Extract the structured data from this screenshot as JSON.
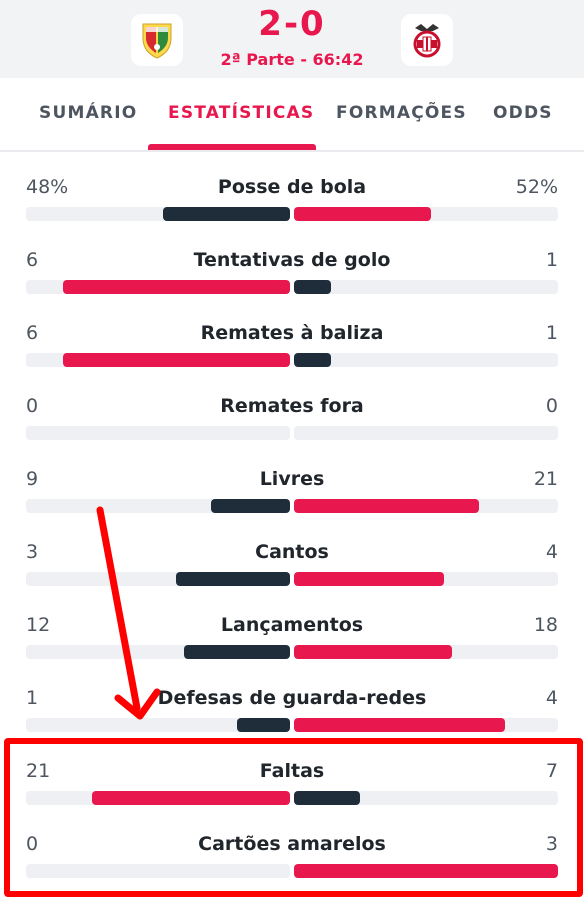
{
  "match": {
    "score": "2-0",
    "period": "2ª Parte - 66:42",
    "home_crest_icon": "estoril-crest-icon",
    "away_crest_icon": "benfica-crest-icon"
  },
  "tabs": [
    {
      "label": "SUMÁRIO"
    },
    {
      "label": "ESTATÍSTICAS",
      "active": true
    },
    {
      "label": "FORMAÇÕES"
    },
    {
      "label": "ODDS"
    }
  ],
  "colors": {
    "accent": "#e8174d",
    "dark_bar": "#1f2d3a",
    "track": "#eef0f3",
    "annotation": "#ff0000"
  },
  "stats": [
    {
      "name": "Posse de bola",
      "left": "48%",
      "right": "52%",
      "left_fill": 0.48,
      "right_fill": 0.52,
      "left_color": "dark",
      "right_color": "accent"
    },
    {
      "name": "Tentativas de golo",
      "left": "6",
      "right": "1",
      "left_fill": 0.86,
      "right_fill": 0.14,
      "left_color": "accent",
      "right_color": "dark"
    },
    {
      "name": "Remates à baliza",
      "left": "6",
      "right": "1",
      "left_fill": 0.86,
      "right_fill": 0.14,
      "left_color": "accent",
      "right_color": "dark"
    },
    {
      "name": "Remates fora",
      "left": "0",
      "right": "0",
      "left_fill": 0,
      "right_fill": 0,
      "left_color": "dark",
      "right_color": "dark"
    },
    {
      "name": "Livres",
      "left": "9",
      "right": "21",
      "left_fill": 0.3,
      "right_fill": 0.7,
      "left_color": "dark",
      "right_color": "accent"
    },
    {
      "name": "Cantos",
      "left": "3",
      "right": "4",
      "left_fill": 0.43,
      "right_fill": 0.57,
      "left_color": "dark",
      "right_color": "accent"
    },
    {
      "name": "Lançamentos",
      "left": "12",
      "right": "18",
      "left_fill": 0.4,
      "right_fill": 0.6,
      "left_color": "dark",
      "right_color": "accent"
    },
    {
      "name": "Defesas de guarda-redes",
      "left": "1",
      "right": "4",
      "left_fill": 0.2,
      "right_fill": 0.8,
      "left_color": "dark",
      "right_color": "accent"
    },
    {
      "name": "Faltas",
      "left": "21",
      "right": "7",
      "left_fill": 0.75,
      "right_fill": 0.25,
      "left_color": "accent",
      "right_color": "dark"
    },
    {
      "name": "Cartões amarelos",
      "left": "0",
      "right": "3",
      "left_fill": 0,
      "right_fill": 1.0,
      "left_color": "dark",
      "right_color": "accent"
    }
  ]
}
